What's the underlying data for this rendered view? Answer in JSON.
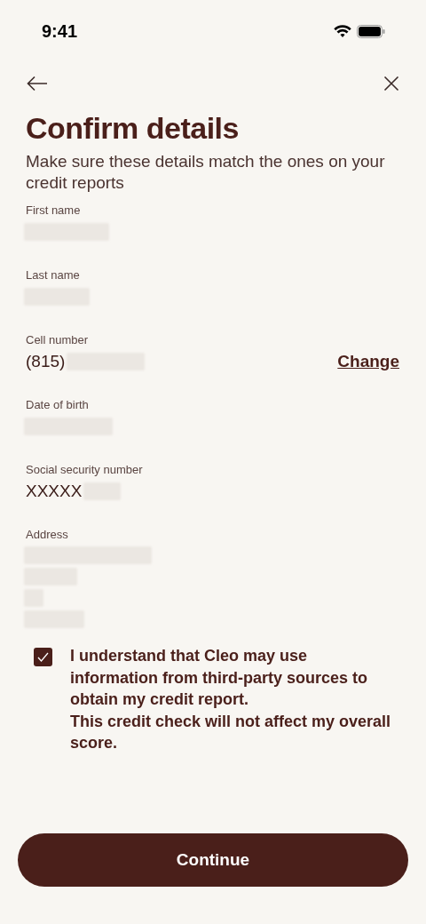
{
  "status_bar": {
    "time": "9:41"
  },
  "title": "Confirm details",
  "subtitle": "Make sure these details match the ones on your credit reports",
  "fields": [
    {
      "label": "First name",
      "value_lines": [
        {
          "redacted": true
        }
      ]
    },
    {
      "label": "Last name",
      "value_lines": [
        {
          "redacted": true
        }
      ]
    },
    {
      "label": "Cell number",
      "value_lines": [
        {
          "text": "(815)",
          "redacted": true
        }
      ],
      "action": "Change"
    },
    {
      "label": "Date of birth",
      "value_lines": [
        {
          "redacted": true
        }
      ]
    },
    {
      "label": "Social security number",
      "value_lines": [
        {
          "text": "XXXXX",
          "redacted": true
        }
      ]
    },
    {
      "label": "Address",
      "value_lines": [
        {
          "redacted": true
        },
        {
          "redacted": true
        },
        {
          "redacted": true
        },
        {
          "redacted": true
        }
      ]
    }
  ],
  "consent": {
    "checked": true,
    "text": "I understand that Cleo may use information from third-party sources to obtain my credit report.\nThis credit check will not affect my overall score."
  },
  "continue_button": "Continue"
}
